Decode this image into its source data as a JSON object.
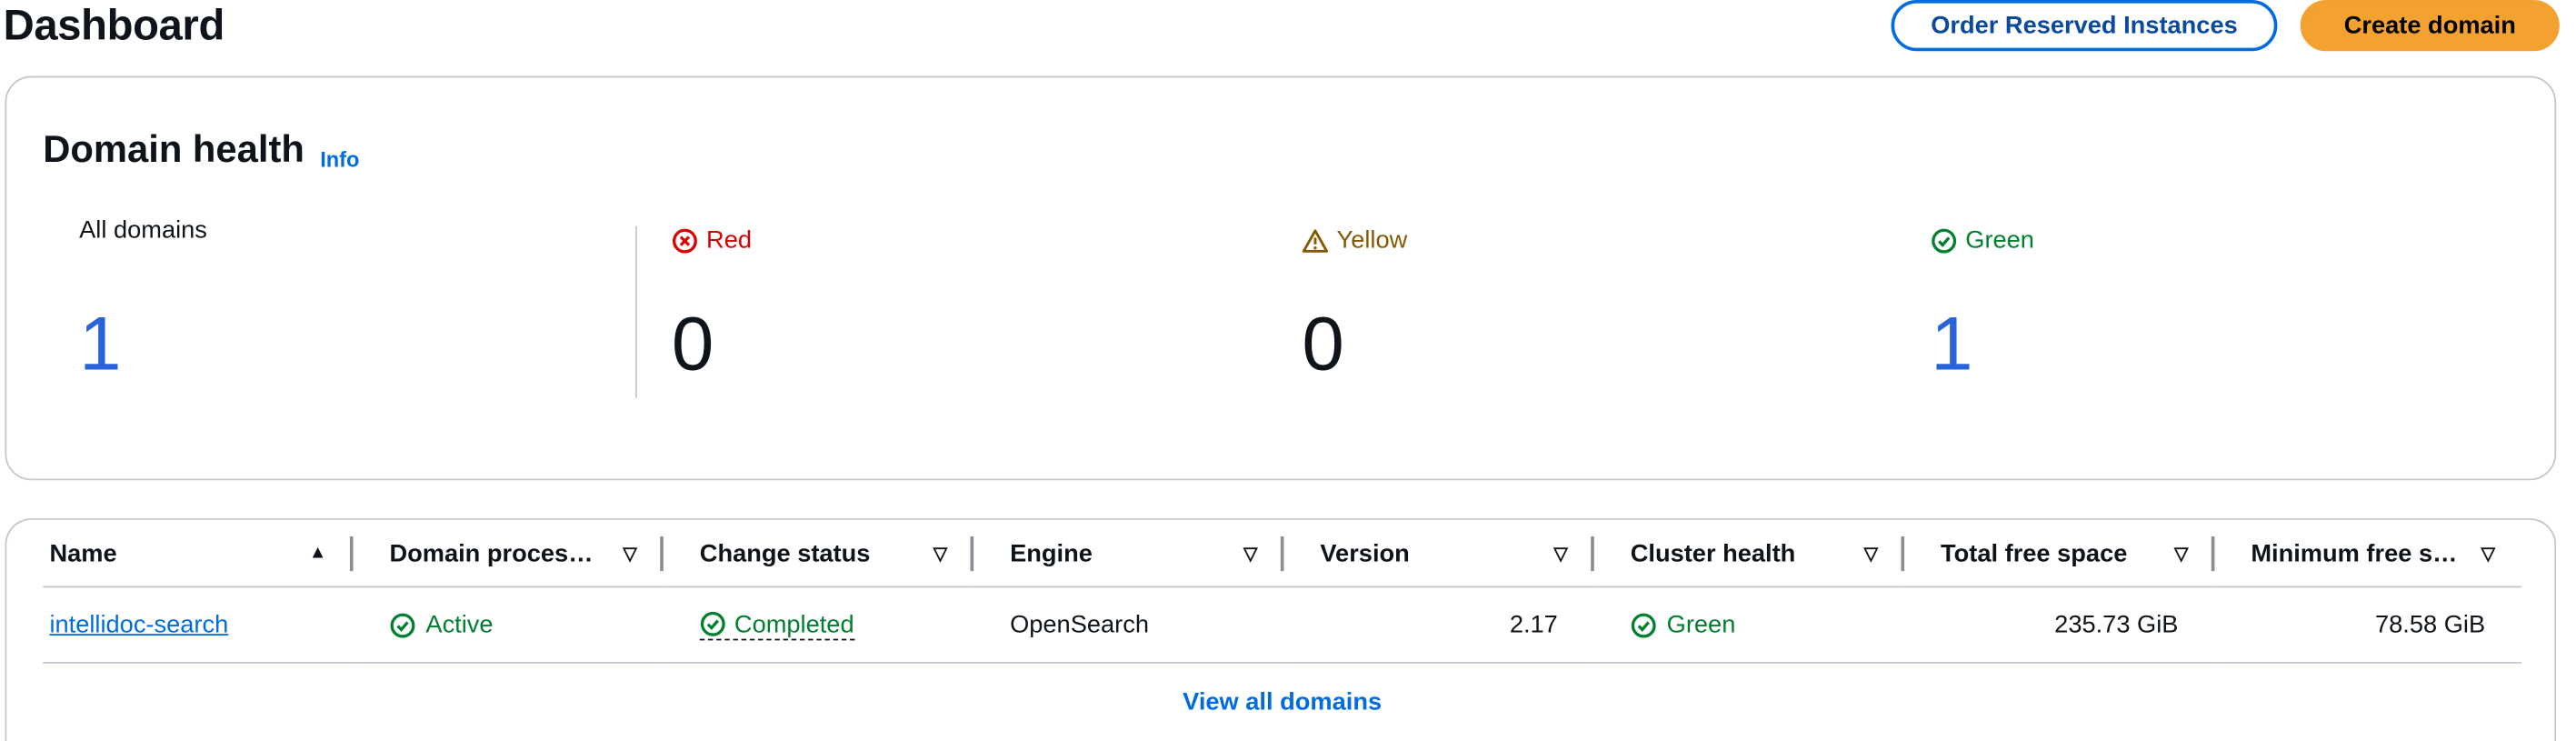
{
  "header": {
    "title": "Dashboard",
    "order_button": "Order Reserved Instances",
    "create_button": "Create domain"
  },
  "health": {
    "title": "Domain health",
    "info": "Info",
    "all": {
      "label": "All domains",
      "value": "1"
    },
    "red": {
      "label": "Red",
      "value": "0",
      "icon": "error-circle-icon",
      "color": "#db0000"
    },
    "yellow": {
      "label": "Yellow",
      "value": "0",
      "icon": "warning-triangle-icon",
      "color": "#855900"
    },
    "green": {
      "label": "Green",
      "value": "1",
      "icon": "check-circle-icon",
      "color": "#00802f"
    }
  },
  "table": {
    "columns": [
      "Name",
      "Domain proces…",
      "Change status",
      "Engine",
      "Version",
      "Cluster health",
      "Total free space",
      "Minimum free s…"
    ],
    "rows": [
      {
        "name": "intellidoc-search",
        "processing": "Active",
        "change_status": "Completed",
        "engine": "OpenSearch",
        "version": "2.17",
        "cluster_health": "Green",
        "total_free": "235.73 GiB",
        "min_free": "78.58 GiB"
      }
    ],
    "view_all": "View all domains"
  },
  "colors": {
    "accent": "#006ce0",
    "primary_button": "#f3a131",
    "value_blue": "#2a63d9"
  }
}
